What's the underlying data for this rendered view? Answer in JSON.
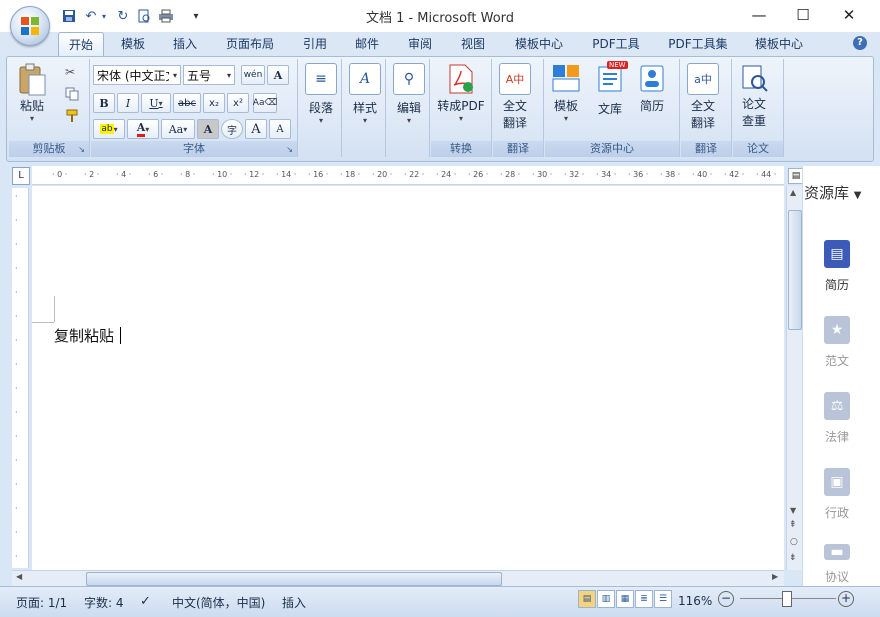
{
  "window": {
    "title": "文档 1 - Microsoft Word",
    "minimize": "—",
    "maximize": "☐",
    "close": "✕"
  },
  "qat": {
    "customize": "▾"
  },
  "tabs": [
    {
      "label": "开始"
    },
    {
      "label": "模板"
    },
    {
      "label": "插入"
    },
    {
      "label": "页面布局"
    },
    {
      "label": "引用"
    },
    {
      "label": "邮件"
    },
    {
      "label": "审阅"
    },
    {
      "label": "视图"
    },
    {
      "label": "模板中心"
    },
    {
      "label": "PDF工具"
    },
    {
      "label": "PDF工具集"
    },
    {
      "label": "模板中心"
    }
  ],
  "help": "?",
  "ribbon": {
    "clipboard": {
      "group": "剪贴板",
      "paste": "粘贴"
    },
    "font": {
      "group": "字体",
      "font_name": "宋体 (中文正文)",
      "font_size": "五号",
      "bold": "B",
      "italic": "I",
      "underline": "U",
      "strike": "abc",
      "subscript": "x₂",
      "superscript": "x²",
      "font_color": "A",
      "change_case": "Aa",
      "char_shading": "A",
      "enclose": "字",
      "grow": "A",
      "shrink": "A"
    },
    "paragraph": {
      "label": "段落"
    },
    "styles": {
      "label": "样式"
    },
    "editing": {
      "label": "编辑"
    },
    "convert": {
      "label": "转成PDF",
      "group": "转换"
    },
    "translate1": {
      "label_1": "全文",
      "label_2": "翻译",
      "group": "翻译"
    },
    "resources": {
      "template": "模板",
      "library": "文库",
      "resume": "简历",
      "group": "资源中心",
      "new_badge": "NEW"
    },
    "translate2": {
      "label_1": "全文",
      "label_2": "翻译",
      "group": "翻译"
    },
    "paper": {
      "label_1": "论文",
      "label_2": "查重",
      "group": "论文"
    }
  },
  "document": {
    "text": "复制粘贴"
  },
  "sidepanel": {
    "title": "资源库",
    "items": [
      {
        "label": "简历"
      },
      {
        "label": "范文"
      },
      {
        "label": "法律"
      },
      {
        "label": "行政"
      },
      {
        "label": "协议"
      }
    ]
  },
  "status": {
    "page": "页面: 1/1",
    "words": "字数: 4",
    "language": "中文(简体，中国)",
    "mode": "插入",
    "zoom": "116%"
  },
  "colors": {
    "accent": "#2b5797",
    "side_active": "#3c5bb8",
    "side_inactive": "#b9c4d8"
  }
}
